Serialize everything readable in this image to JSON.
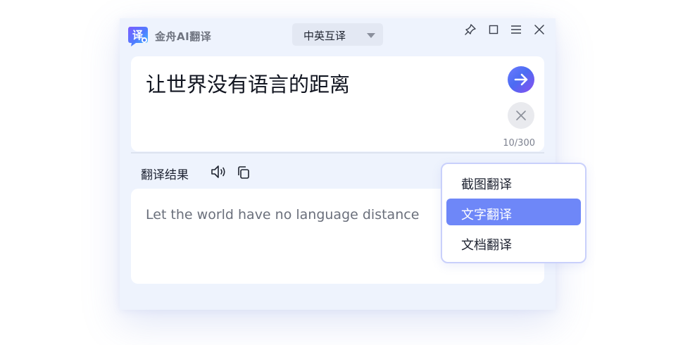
{
  "app": {
    "name": "金舟AI翻译",
    "logo_glyph": "译"
  },
  "toolbar": {
    "language_pair": "中英互译",
    "icons": [
      "pin-icon",
      "maximize-icon",
      "menu-icon",
      "close-icon"
    ]
  },
  "input": {
    "text": "让世界没有语言的距离",
    "char_count": "10/300"
  },
  "result": {
    "label": "翻译结果",
    "text": "Let the world have no language distance"
  },
  "menu": {
    "items": [
      {
        "label": "截图翻译",
        "active": false
      },
      {
        "label": "文字翻译",
        "active": true
      },
      {
        "label": "文档翻译",
        "active": false
      }
    ]
  },
  "colors": {
    "accent": "#6e87f8",
    "go_button_start": "#6d7bff",
    "go_button_end": "#8a4ef0",
    "window_bg": "#eef3fd"
  }
}
